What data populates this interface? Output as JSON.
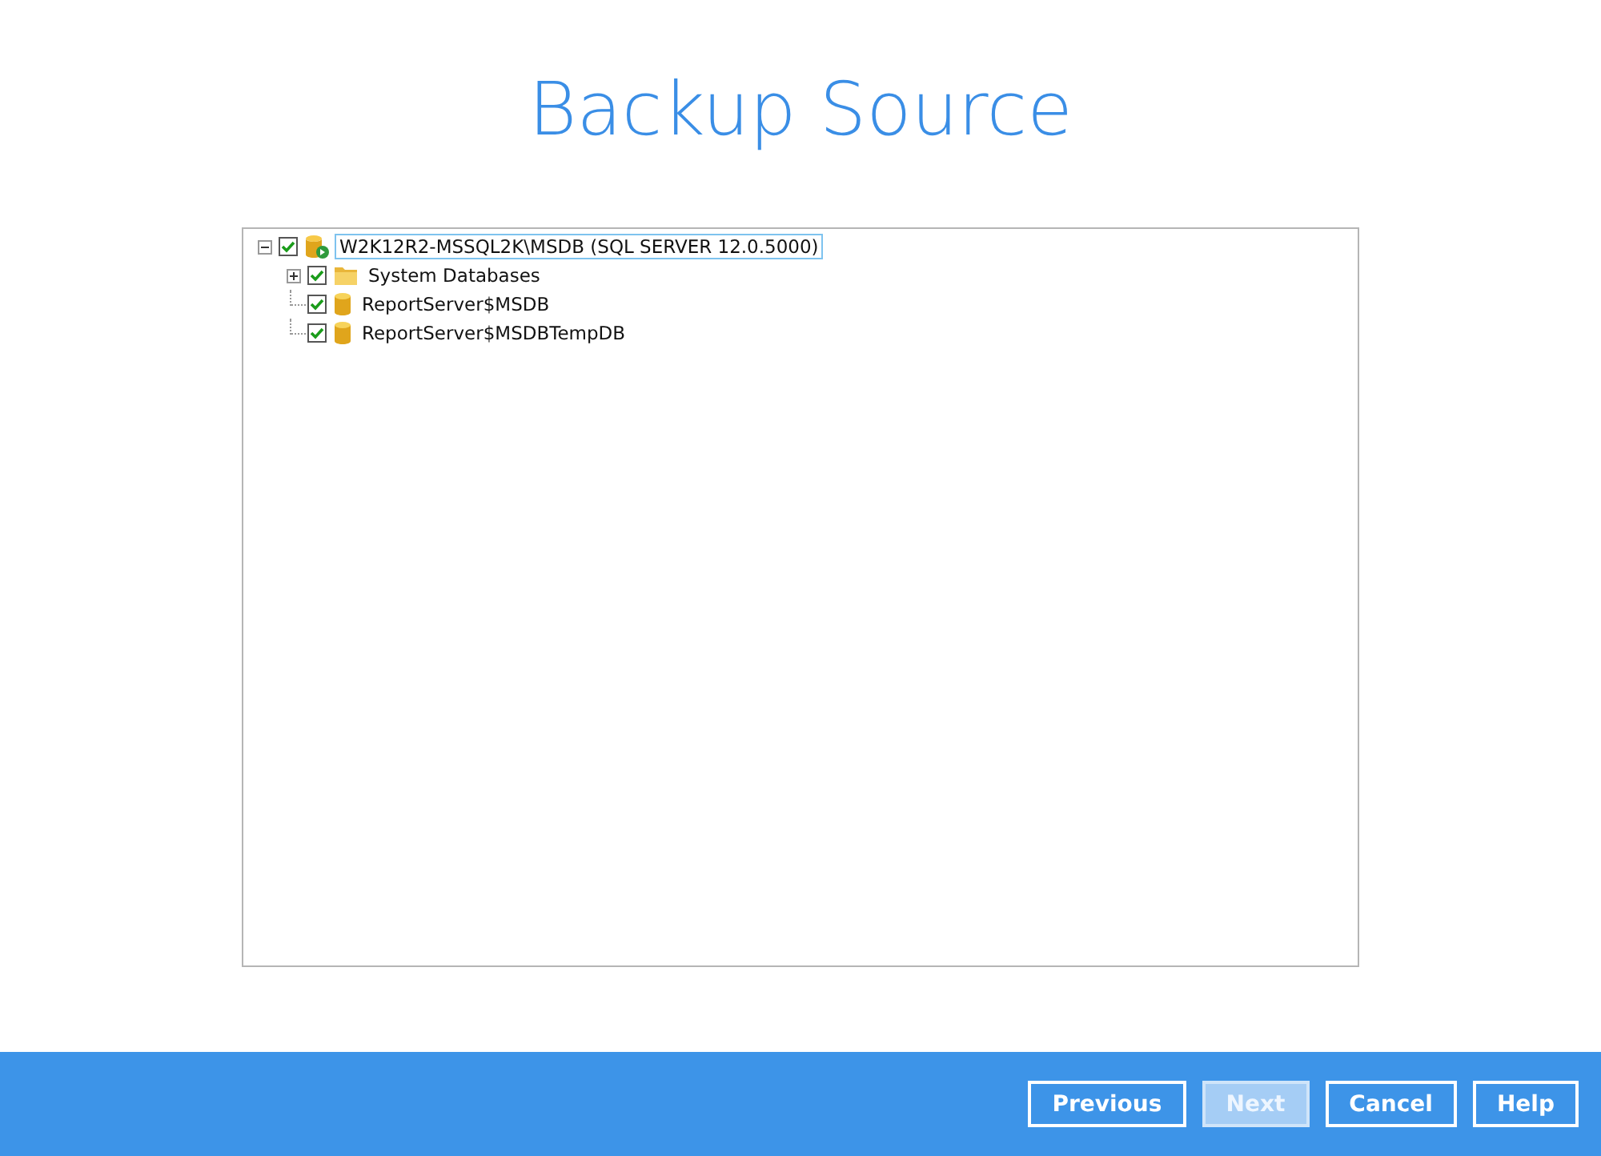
{
  "title": "Backup Source",
  "tree": [
    {
      "label": "W2K12R2-MSSQL2K\\MSDB (SQL SERVER 12.0.5000)",
      "kind": "server",
      "checked": true,
      "selected": true,
      "expanded": true,
      "children": [
        {
          "label": "System Databases",
          "kind": "folder",
          "checked": true,
          "selected": false,
          "expanded": false
        },
        {
          "label": "ReportServer$MSDB",
          "kind": "database",
          "checked": true,
          "selected": false
        },
        {
          "label": "ReportServer$MSDBTempDB",
          "kind": "database",
          "checked": true,
          "selected": false
        }
      ]
    }
  ],
  "buttons": [
    {
      "label": "Previous",
      "disabled": false
    },
    {
      "label": "Next",
      "disabled": true
    },
    {
      "label": "Cancel",
      "disabled": false
    },
    {
      "label": "Help",
      "disabled": false
    }
  ]
}
